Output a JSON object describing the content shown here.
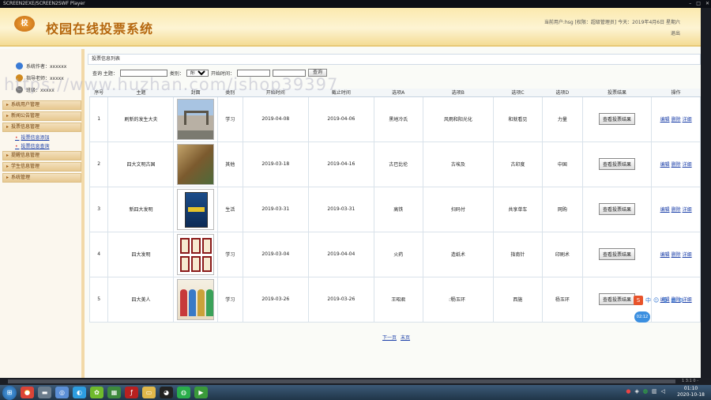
{
  "window": {
    "title": "SCREEN2EXE/SCREEN2SWF Player"
  },
  "header": {
    "logo": "校",
    "title": "校园在线投票系统",
    "userinfo": "当前用户:hsg [权限：超级管理员] 今天：2019年4月6日 星期六",
    "logout": "退出"
  },
  "sidebar": {
    "info": [
      {
        "label": "系统作者：xxxxxx",
        "color": "#3a7bd5"
      },
      {
        "label": "指导老师：xxxxx",
        "color": "#d08a20"
      },
      {
        "label": "班级：xxxxx",
        "color": "#7a7a7a"
      }
    ],
    "menu": [
      {
        "label": "系统用户管理",
        "subs": []
      },
      {
        "label": "新闻公告管理",
        "subs": []
      },
      {
        "label": "投票信息管理",
        "subs": [
          "投票信息添加",
          "投票信息查询"
        ]
      },
      {
        "label": "提醒信息管理",
        "subs": []
      },
      {
        "label": "学生信息管理",
        "subs": []
      },
      {
        "label": "系统管理",
        "subs": []
      }
    ]
  },
  "panel": {
    "title": "投票信息列表"
  },
  "search": {
    "query_label": "查询 主题：",
    "type_label": "类别：",
    "type_value": "所有",
    "time_label": "开始时间：",
    "button": "查询"
  },
  "table": {
    "headers": [
      "序号",
      "主题",
      "封面",
      "类别",
      "开始时间",
      "截止时间",
      "选项A",
      "选项B",
      "选项C",
      "选项D",
      "投票结果",
      "操作"
    ],
    "result_button": "查看投票结果",
    "actions": [
      "编辑",
      "删除",
      "详细"
    ],
    "rows": [
      {
        "no": "1",
        "topic": "刷新的发生大夫",
        "cover": "gate",
        "category": "学习",
        "start": "2019-04-08",
        "end": "2019-04-06",
        "a": "黑地冷氏",
        "b": "风雨和阳光化",
        "c": "和就看见",
        "d": "力量"
      },
      {
        "no": "2",
        "topic": "四大文明古国",
        "cover": "wall",
        "category": "其他",
        "start": "2019-03-18",
        "end": "2019-04-16",
        "a": "古巴比伦",
        "b": "古埃及",
        "c": "古印度",
        "d": "中国"
      },
      {
        "no": "3",
        "topic": "新四大发明",
        "cover": "book",
        "category": "生活",
        "start": "2019-03-31",
        "end": "2019-03-31",
        "a": "高铁",
        "b": "扫码付",
        "c": "共享单车",
        "d": "网购"
      },
      {
        "no": "4",
        "topic": "四大发明",
        "cover": "grid",
        "category": "学习",
        "start": "2019-03-04",
        "end": "2019-04-04",
        "a": "火药",
        "b": "造纸术",
        "c": "指南针",
        "d": "印刷术"
      },
      {
        "no": "5",
        "topic": "四大美人",
        "cover": "poster",
        "category": "学习",
        "start": "2019-03-26",
        "end": "2019-03-26",
        "a": "王昭君",
        "b": "杨玉环",
        "c": "西施",
        "d": "杨玉环"
      }
    ]
  },
  "pager": {
    "next": "下一页",
    "last": "末页"
  },
  "watermark": "https://www.huzhan.com/ishop39397",
  "ime": {
    "logo": "S",
    "label": "中"
  },
  "timer": "02:12",
  "scrollinfo": "1 3:1 0 -",
  "clock": {
    "time": "01:10",
    "date": "2020-10-18"
  },
  "colors": {
    "accent": "#b5670e",
    "link": "#1a3ea8",
    "header": "#fbe9ae"
  }
}
